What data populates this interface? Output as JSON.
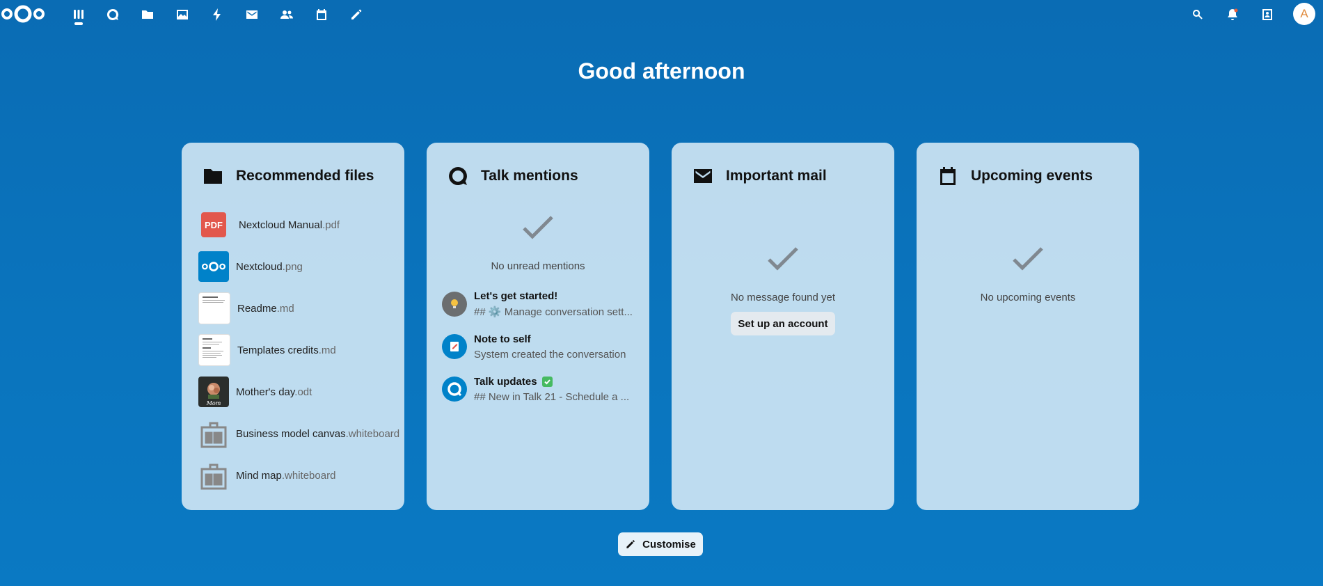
{
  "topbar": {
    "apps": [
      {
        "name": "dashboard",
        "icon": "dashboard-icon"
      },
      {
        "name": "talk",
        "icon": "talk-icon"
      },
      {
        "name": "files",
        "icon": "folder-icon"
      },
      {
        "name": "photos",
        "icon": "image-icon"
      },
      {
        "name": "activity",
        "icon": "lightning-icon"
      },
      {
        "name": "mail",
        "icon": "mail-icon"
      },
      {
        "name": "contacts",
        "icon": "contacts-icon"
      },
      {
        "name": "calendar",
        "icon": "calendar-icon"
      },
      {
        "name": "notes",
        "icon": "pencil-icon"
      }
    ],
    "right_icons": [
      "search-icon",
      "bell-icon",
      "contacts-menu-icon"
    ],
    "avatar_letter": "A"
  },
  "greeting": "Good afternoon",
  "widgets": {
    "files": {
      "title": "Recommended files",
      "items": [
        {
          "name": "Nextcloud Manual",
          "ext": ".pdf",
          "thumb": "pdf"
        },
        {
          "name": "Nextcloud",
          "ext": ".png",
          "thumb": "nextcloud"
        },
        {
          "name": "Readme",
          "ext": ".md",
          "thumb": "doc"
        },
        {
          "name": "Templates credits",
          "ext": ".md",
          "thumb": "doc"
        },
        {
          "name": "Mother's day",
          "ext": ".odt",
          "thumb": "photo"
        },
        {
          "name": "Business model canvas",
          "ext": ".whiteboard",
          "thumb": "whiteboard"
        },
        {
          "name": "Mind map",
          "ext": ".whiteboard",
          "thumb": "whiteboard"
        }
      ],
      "pdf_badge": "PDF",
      "mom_label": "Mom"
    },
    "talk": {
      "title": "Talk mentions",
      "empty": "No unread mentions",
      "conversations": [
        {
          "title": "Let's get started!",
          "subtitle": "## ⚙️ Manage conversation sett...",
          "avatar": "bulb"
        },
        {
          "title": "Note to self",
          "subtitle": "System created the conversation",
          "avatar": "note"
        },
        {
          "title": "Talk updates",
          "subtitle": "## New in Talk 21 - Schedule a ...",
          "avatar": "talk"
        }
      ]
    },
    "mail": {
      "title": "Important mail",
      "empty": "No message found yet",
      "button": "Set up an account"
    },
    "events": {
      "title": "Upcoming events",
      "empty": "No upcoming events"
    }
  },
  "customise_label": "Customise",
  "colors": {
    "brand": "#0082c9",
    "pdf": "#e2574c",
    "accent": "#e08a3c",
    "check_badge": "#46ba61"
  }
}
